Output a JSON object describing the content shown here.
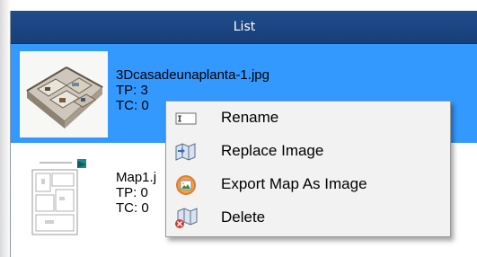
{
  "panel": {
    "title": "List"
  },
  "items": [
    {
      "name": "3Dcasadeunaplanta-1.jpg",
      "tp": "TP: 3",
      "tc": "TC: 0",
      "selected": true
    },
    {
      "name": "Map1.j",
      "tp": "TP: 0",
      "tc": "TC: 0",
      "selected": false
    }
  ],
  "context_menu": {
    "items": [
      {
        "label": "Rename",
        "icon": "rename-icon"
      },
      {
        "label": "Replace Image",
        "icon": "replace-image-icon"
      },
      {
        "label": "Export Map As Image",
        "icon": "export-image-icon"
      },
      {
        "label": "Delete",
        "icon": "delete-icon"
      }
    ]
  },
  "colors": {
    "header": "#1f4d8b",
    "selection": "#3399ff",
    "menu_background": "#f2f2f2"
  }
}
